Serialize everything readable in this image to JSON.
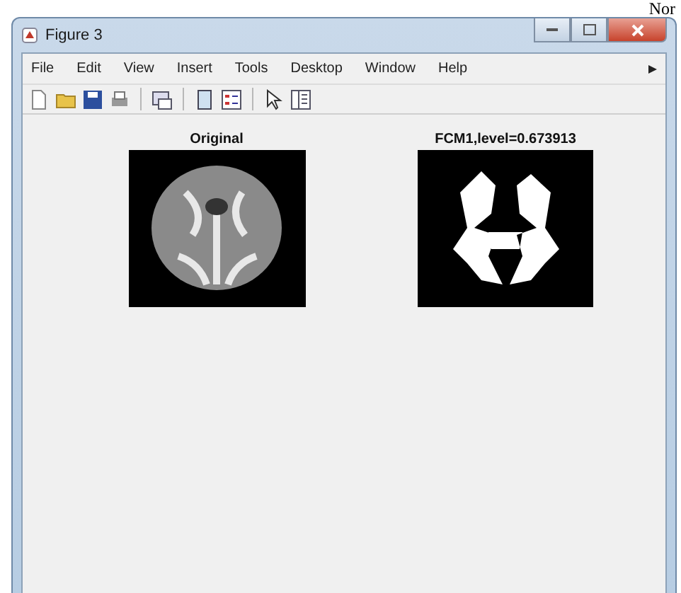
{
  "page_text": "Nor",
  "window": {
    "title": "Figure 3"
  },
  "menu": [
    "File",
    "Edit",
    "View",
    "Insert",
    "Tools",
    "Desktop",
    "Window",
    "Help"
  ],
  "axes": [
    {
      "title": "Original",
      "kind": "grayscale"
    },
    {
      "title": "FCM1,level=0.673913",
      "kind": "binary"
    }
  ]
}
